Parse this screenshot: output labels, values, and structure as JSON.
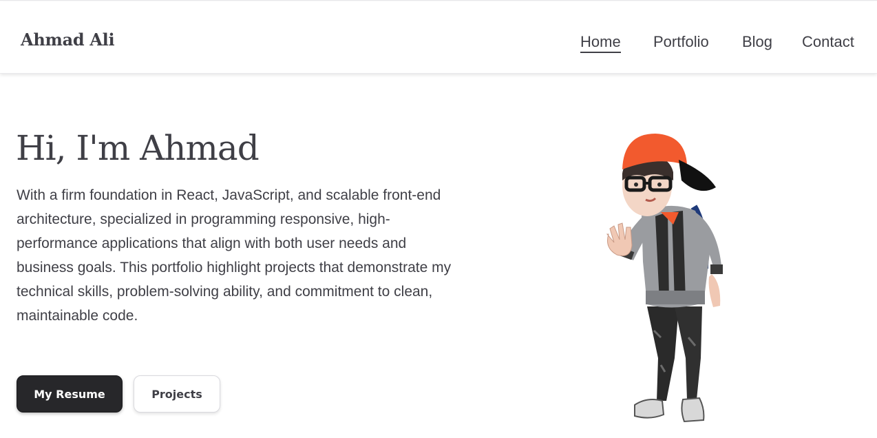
{
  "header": {
    "brand": "Ahmad Ali",
    "nav": [
      {
        "label": "Home",
        "active": true
      },
      {
        "label": "Portfolio",
        "active": false
      },
      {
        "label": "Blog",
        "active": false
      },
      {
        "label": "Contact",
        "active": false
      }
    ]
  },
  "hero": {
    "title": "Hi, I'm Ahmad",
    "description": "With a firm foundation in React, JavaScript, and scalable front-end architecture, specialized in programming responsive, high-performance applications that align with both user needs and business goals. This portfolio highlight projects that demonstrate my technical skills, problem-solving ability, and commitment to clean, maintainable code.",
    "buttons": {
      "primary_label": "My Resume",
      "secondary_label": "Projects"
    }
  },
  "colors": {
    "text": "#3f3f46",
    "primary_button": "#27272a",
    "cap": "#f25a2e",
    "hoodie": "#9a9ca0"
  }
}
